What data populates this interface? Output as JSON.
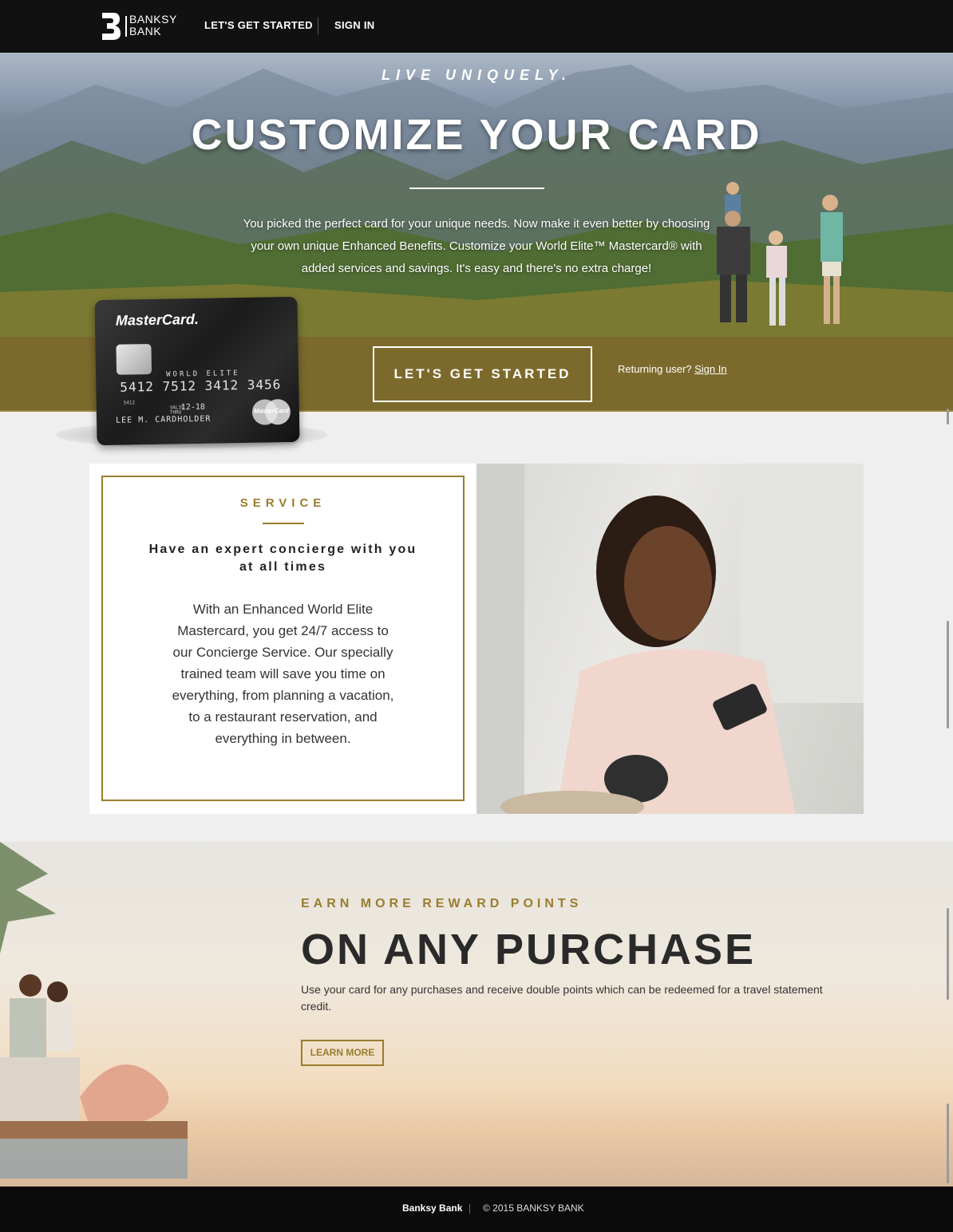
{
  "nav": {
    "logo_line1": "BANKSY",
    "logo_line2": "BANK",
    "link_get_started": "LET'S GET STARTED",
    "link_sign_in": "SIGN IN"
  },
  "hero": {
    "tagline": "LIVE UNIQUELY.",
    "title": "CUSTOMIZE YOUR CARD",
    "copy": "You picked the perfect card for your unique needs. Now make it even better by choosing your own unique Enhanced Benefits. Customize your World Elite™ Mastercard® with added services and savings. It's easy and there's no extra charge!"
  },
  "band": {
    "cta_label": "LET'S GET STARTED",
    "returning_text": "Returning user?",
    "sign_in_link": "Sign In"
  },
  "card": {
    "brand": "MasterCard.",
    "tier": "WORLD ELITE",
    "number": "5412 7512 3412 3456",
    "small_number": "5412",
    "valid_label": "VALID THRU",
    "expiry": "12-18",
    "holder": "LEE M. CARDHOLDER",
    "logo_text": "MasterCard"
  },
  "service": {
    "label": "SERVICE",
    "heading": "Have an expert concierge with you at all times",
    "body": "With an Enhanced World Elite Mastercard, you get 24/7 access to our Concierge Service. Our specially trained team will save you time on everything, from planning a vacation, to a restaurant reservation, and everything in between."
  },
  "rewards": {
    "label": "EARN MORE REWARD POINTS",
    "title": "ON ANY PURCHASE",
    "copy": "Use your card for any purchases and receive double points which can be redeemed for a travel statement credit.",
    "button": "LEARN MORE"
  },
  "footer": {
    "brand": "Banksy Bank",
    "copyright": "© 2015 BANKSY BANK"
  },
  "colors": {
    "accent_gold": "#9a7d2e",
    "band_gold": "#7c6a2c",
    "nav_bg": "#111111"
  }
}
